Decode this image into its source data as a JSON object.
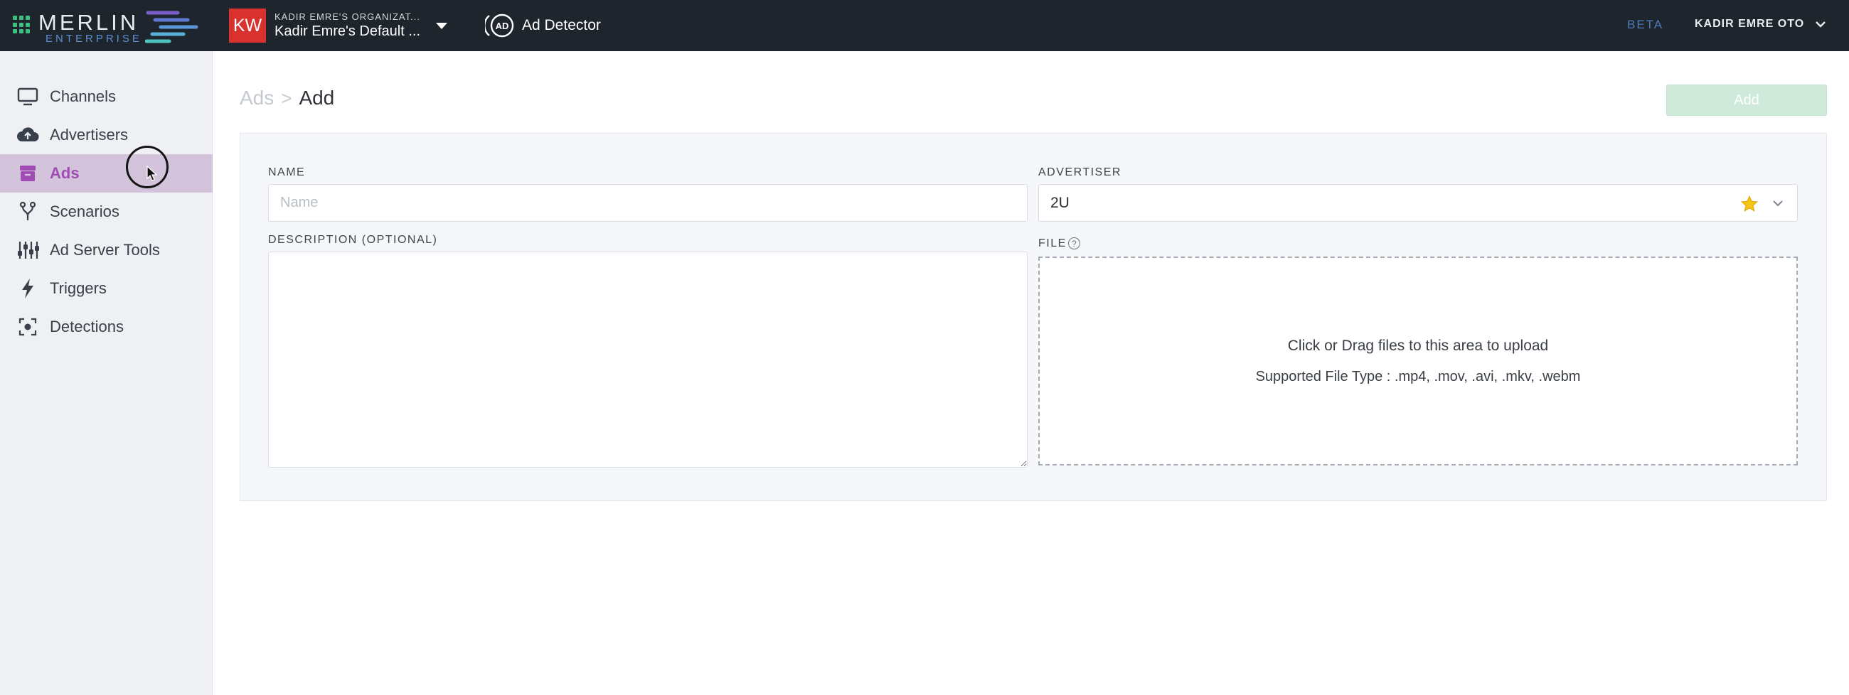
{
  "app": {
    "brand_name": "MERLIN",
    "brand_sub": "ENTERPRISE"
  },
  "org": {
    "initials": "KW",
    "org_name": "KADIR EMRE'S ORGANIZAT...",
    "workspace": "Kadir Emre's Default ..."
  },
  "product": {
    "label": "Ad Detector",
    "icon_text": "AD"
  },
  "header": {
    "beta": "BETA",
    "user": "KADIR EMRE OTO"
  },
  "sidebar": {
    "items": [
      {
        "label": "Channels",
        "icon": "monitor-icon"
      },
      {
        "label": "Advertisers",
        "icon": "cloud-upload-icon"
      },
      {
        "label": "Ads",
        "icon": "archive-box-icon",
        "active": true
      },
      {
        "label": "Scenarios",
        "icon": "branch-icon"
      },
      {
        "label": "Ad Server Tools",
        "icon": "sliders-icon"
      },
      {
        "label": "Triggers",
        "icon": "lightning-icon"
      },
      {
        "label": "Detections",
        "icon": "focus-target-icon"
      }
    ]
  },
  "breadcrumb": {
    "parent": "Ads",
    "separator": ">",
    "current": "Add"
  },
  "toolbar": {
    "add_label": "Add"
  },
  "form": {
    "name_label": "NAME",
    "name_placeholder": "Name",
    "name_value": "",
    "advertiser_label": "ADVERTISER",
    "advertiser_value": "2U",
    "description_label": "DESCRIPTION (OPTIONAL)",
    "description_value": "",
    "file_label": "FILE",
    "file_help": "?",
    "dropzone_title": "Click or Drag files to this area to upload",
    "dropzone_types": "Supported File Type : .mp4, .mov, .avi, .mkv, .webm"
  },
  "colors": {
    "topbar": "#1f252c",
    "accent_active": "#a04cb3",
    "active_bg": "#d3c4db",
    "add_button": "#cfeadb",
    "brand_green": "#3fbf7f",
    "star": "#f5c518"
  }
}
